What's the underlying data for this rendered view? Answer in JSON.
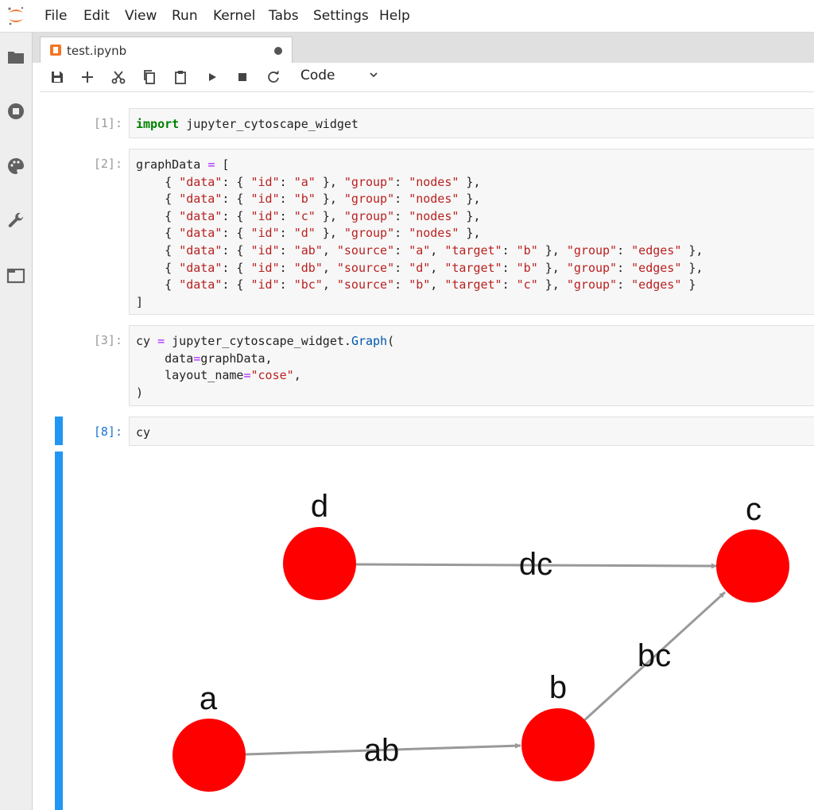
{
  "menu": [
    "File",
    "Edit",
    "View",
    "Run",
    "Kernel",
    "Tabs",
    "Settings",
    "Help"
  ],
  "sidebar_icons": [
    "folder-icon",
    "running-stop-icon",
    "palette-icon",
    "wrench-icon",
    "tabs-icon"
  ],
  "tab": {
    "name": "test.ipynb",
    "unsaved": true
  },
  "toolbar": {
    "buttons": [
      "save-icon",
      "add-cell-icon",
      "cut-icon",
      "copy-icon",
      "paste-icon",
      "run-icon",
      "stop-icon",
      "restart-icon"
    ],
    "cell_type": "Code"
  },
  "cells": [
    {
      "prompt": "[1]:",
      "lines": [
        [
          {
            "t": "import",
            "c": "kw"
          },
          {
            "t": " jupyter_cytoscape_widget",
            "c": ""
          }
        ]
      ]
    },
    {
      "prompt": "[2]:",
      "lines": [
        [
          {
            "t": "graphData ",
            "c": ""
          },
          {
            "t": "=",
            "c": "op"
          },
          {
            "t": " [",
            "c": ""
          }
        ],
        [
          {
            "t": "    { ",
            "c": ""
          },
          {
            "t": "\"data\"",
            "c": "str"
          },
          {
            "t": ": { ",
            "c": ""
          },
          {
            "t": "\"id\"",
            "c": "str"
          },
          {
            "t": ": ",
            "c": ""
          },
          {
            "t": "\"a\"",
            "c": "str"
          },
          {
            "t": " }, ",
            "c": ""
          },
          {
            "t": "\"group\"",
            "c": "str"
          },
          {
            "t": ": ",
            "c": ""
          },
          {
            "t": "\"nodes\"",
            "c": "str"
          },
          {
            "t": " },",
            "c": ""
          }
        ],
        [
          {
            "t": "    { ",
            "c": ""
          },
          {
            "t": "\"data\"",
            "c": "str"
          },
          {
            "t": ": { ",
            "c": ""
          },
          {
            "t": "\"id\"",
            "c": "str"
          },
          {
            "t": ": ",
            "c": ""
          },
          {
            "t": "\"b\"",
            "c": "str"
          },
          {
            "t": " }, ",
            "c": ""
          },
          {
            "t": "\"group\"",
            "c": "str"
          },
          {
            "t": ": ",
            "c": ""
          },
          {
            "t": "\"nodes\"",
            "c": "str"
          },
          {
            "t": " },",
            "c": ""
          }
        ],
        [
          {
            "t": "    { ",
            "c": ""
          },
          {
            "t": "\"data\"",
            "c": "str"
          },
          {
            "t": ": { ",
            "c": ""
          },
          {
            "t": "\"id\"",
            "c": "str"
          },
          {
            "t": ": ",
            "c": ""
          },
          {
            "t": "\"c\"",
            "c": "str"
          },
          {
            "t": " }, ",
            "c": ""
          },
          {
            "t": "\"group\"",
            "c": "str"
          },
          {
            "t": ": ",
            "c": ""
          },
          {
            "t": "\"nodes\"",
            "c": "str"
          },
          {
            "t": " },",
            "c": ""
          }
        ],
        [
          {
            "t": "    { ",
            "c": ""
          },
          {
            "t": "\"data\"",
            "c": "str"
          },
          {
            "t": ": { ",
            "c": ""
          },
          {
            "t": "\"id\"",
            "c": "str"
          },
          {
            "t": ": ",
            "c": ""
          },
          {
            "t": "\"d\"",
            "c": "str"
          },
          {
            "t": " }, ",
            "c": ""
          },
          {
            "t": "\"group\"",
            "c": "str"
          },
          {
            "t": ": ",
            "c": ""
          },
          {
            "t": "\"nodes\"",
            "c": "str"
          },
          {
            "t": " },",
            "c": ""
          }
        ],
        [
          {
            "t": "    { ",
            "c": ""
          },
          {
            "t": "\"data\"",
            "c": "str"
          },
          {
            "t": ": { ",
            "c": ""
          },
          {
            "t": "\"id\"",
            "c": "str"
          },
          {
            "t": ": ",
            "c": ""
          },
          {
            "t": "\"ab\"",
            "c": "str"
          },
          {
            "t": ", ",
            "c": ""
          },
          {
            "t": "\"source\"",
            "c": "str"
          },
          {
            "t": ": ",
            "c": ""
          },
          {
            "t": "\"a\"",
            "c": "str"
          },
          {
            "t": ", ",
            "c": ""
          },
          {
            "t": "\"target\"",
            "c": "str"
          },
          {
            "t": ": ",
            "c": ""
          },
          {
            "t": "\"b\"",
            "c": "str"
          },
          {
            "t": " }, ",
            "c": ""
          },
          {
            "t": "\"group\"",
            "c": "str"
          },
          {
            "t": ": ",
            "c": ""
          },
          {
            "t": "\"edges\"",
            "c": "str"
          },
          {
            "t": " },",
            "c": ""
          }
        ],
        [
          {
            "t": "    { ",
            "c": ""
          },
          {
            "t": "\"data\"",
            "c": "str"
          },
          {
            "t": ": { ",
            "c": ""
          },
          {
            "t": "\"id\"",
            "c": "str"
          },
          {
            "t": ": ",
            "c": ""
          },
          {
            "t": "\"db\"",
            "c": "str"
          },
          {
            "t": ", ",
            "c": ""
          },
          {
            "t": "\"source\"",
            "c": "str"
          },
          {
            "t": ": ",
            "c": ""
          },
          {
            "t": "\"d\"",
            "c": "str"
          },
          {
            "t": ", ",
            "c": ""
          },
          {
            "t": "\"target\"",
            "c": "str"
          },
          {
            "t": ": ",
            "c": ""
          },
          {
            "t": "\"b\"",
            "c": "str"
          },
          {
            "t": " }, ",
            "c": ""
          },
          {
            "t": "\"group\"",
            "c": "str"
          },
          {
            "t": ": ",
            "c": ""
          },
          {
            "t": "\"edges\"",
            "c": "str"
          },
          {
            "t": " },",
            "c": ""
          }
        ],
        [
          {
            "t": "    { ",
            "c": ""
          },
          {
            "t": "\"data\"",
            "c": "str"
          },
          {
            "t": ": { ",
            "c": ""
          },
          {
            "t": "\"id\"",
            "c": "str"
          },
          {
            "t": ": ",
            "c": ""
          },
          {
            "t": "\"bc\"",
            "c": "str"
          },
          {
            "t": ", ",
            "c": ""
          },
          {
            "t": "\"source\"",
            "c": "str"
          },
          {
            "t": ": ",
            "c": ""
          },
          {
            "t": "\"b\"",
            "c": "str"
          },
          {
            "t": ", ",
            "c": ""
          },
          {
            "t": "\"target\"",
            "c": "str"
          },
          {
            "t": ": ",
            "c": ""
          },
          {
            "t": "\"c\"",
            "c": "str"
          },
          {
            "t": " }, ",
            "c": ""
          },
          {
            "t": "\"group\"",
            "c": "str"
          },
          {
            "t": ": ",
            "c": ""
          },
          {
            "t": "\"edges\"",
            "c": "str"
          },
          {
            "t": " }",
            "c": ""
          }
        ],
        [
          {
            "t": "]",
            "c": ""
          }
        ]
      ]
    },
    {
      "prompt": "[3]:",
      "lines": [
        [
          {
            "t": "cy ",
            "c": ""
          },
          {
            "t": "=",
            "c": "op"
          },
          {
            "t": " jupyter_cytoscape_widget.",
            "c": ""
          },
          {
            "t": "Graph",
            "c": "fn"
          },
          {
            "t": "(",
            "c": ""
          }
        ],
        [
          {
            "t": "    data",
            "c": ""
          },
          {
            "t": "=",
            "c": "op"
          },
          {
            "t": "graphData,",
            "c": ""
          }
        ],
        [
          {
            "t": "    layout_name",
            "c": ""
          },
          {
            "t": "=",
            "c": "op"
          },
          {
            "t": "\"cose\"",
            "c": "str"
          },
          {
            "t": ",",
            "c": ""
          }
        ],
        [
          {
            "t": ")",
            "c": ""
          }
        ]
      ]
    },
    {
      "prompt": "[8]:",
      "active": true,
      "lines": [
        [
          {
            "t": "cy",
            "c": ""
          }
        ]
      ]
    }
  ],
  "graph": {
    "node_color": "#ff0000",
    "edge_color": "#999999",
    "nodes": [
      {
        "id": "d",
        "label": "d"
      },
      {
        "id": "c",
        "label": "c"
      },
      {
        "id": "a",
        "label": "a"
      },
      {
        "id": "b",
        "label": "b"
      }
    ],
    "edges": [
      {
        "id": "dc",
        "label": "dc",
        "source": "d",
        "target": "c"
      },
      {
        "id": "ab",
        "label": "ab",
        "source": "a",
        "target": "b"
      },
      {
        "id": "bc",
        "label": "bc",
        "source": "b",
        "target": "c"
      }
    ]
  }
}
